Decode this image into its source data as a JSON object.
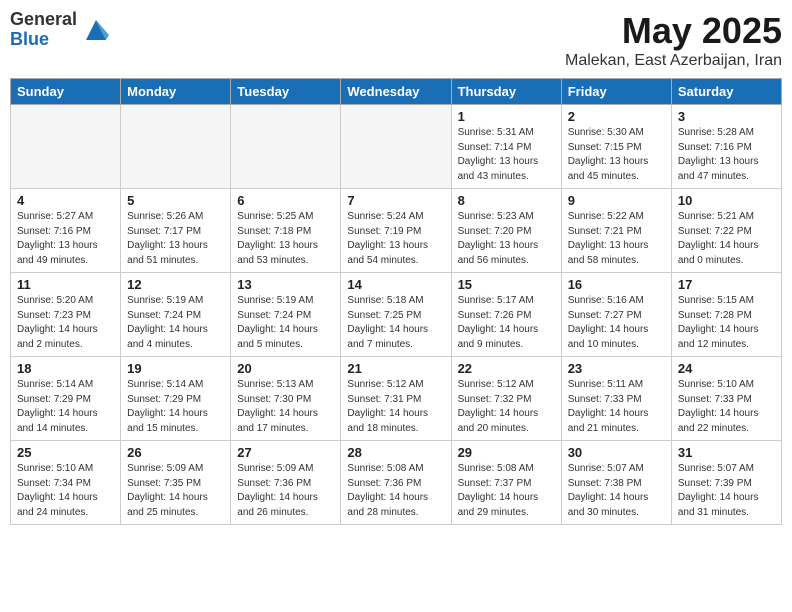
{
  "logo": {
    "general": "General",
    "blue": "Blue"
  },
  "title": {
    "month": "May 2025",
    "location": "Malekan, East Azerbaijan, Iran"
  },
  "headers": [
    "Sunday",
    "Monday",
    "Tuesday",
    "Wednesday",
    "Thursday",
    "Friday",
    "Saturday"
  ],
  "weeks": [
    [
      {
        "day": "",
        "info": "",
        "empty": true
      },
      {
        "day": "",
        "info": "",
        "empty": true
      },
      {
        "day": "",
        "info": "",
        "empty": true
      },
      {
        "day": "",
        "info": "",
        "empty": true
      },
      {
        "day": "1",
        "info": "Sunrise: 5:31 AM\nSunset: 7:14 PM\nDaylight: 13 hours\nand 43 minutes."
      },
      {
        "day": "2",
        "info": "Sunrise: 5:30 AM\nSunset: 7:15 PM\nDaylight: 13 hours\nand 45 minutes."
      },
      {
        "day": "3",
        "info": "Sunrise: 5:28 AM\nSunset: 7:16 PM\nDaylight: 13 hours\nand 47 minutes."
      }
    ],
    [
      {
        "day": "4",
        "info": "Sunrise: 5:27 AM\nSunset: 7:16 PM\nDaylight: 13 hours\nand 49 minutes."
      },
      {
        "day": "5",
        "info": "Sunrise: 5:26 AM\nSunset: 7:17 PM\nDaylight: 13 hours\nand 51 minutes."
      },
      {
        "day": "6",
        "info": "Sunrise: 5:25 AM\nSunset: 7:18 PM\nDaylight: 13 hours\nand 53 minutes."
      },
      {
        "day": "7",
        "info": "Sunrise: 5:24 AM\nSunset: 7:19 PM\nDaylight: 13 hours\nand 54 minutes."
      },
      {
        "day": "8",
        "info": "Sunrise: 5:23 AM\nSunset: 7:20 PM\nDaylight: 13 hours\nand 56 minutes."
      },
      {
        "day": "9",
        "info": "Sunrise: 5:22 AM\nSunset: 7:21 PM\nDaylight: 13 hours\nand 58 minutes."
      },
      {
        "day": "10",
        "info": "Sunrise: 5:21 AM\nSunset: 7:22 PM\nDaylight: 14 hours\nand 0 minutes."
      }
    ],
    [
      {
        "day": "11",
        "info": "Sunrise: 5:20 AM\nSunset: 7:23 PM\nDaylight: 14 hours\nand 2 minutes."
      },
      {
        "day": "12",
        "info": "Sunrise: 5:19 AM\nSunset: 7:24 PM\nDaylight: 14 hours\nand 4 minutes."
      },
      {
        "day": "13",
        "info": "Sunrise: 5:19 AM\nSunset: 7:24 PM\nDaylight: 14 hours\nand 5 minutes."
      },
      {
        "day": "14",
        "info": "Sunrise: 5:18 AM\nSunset: 7:25 PM\nDaylight: 14 hours\nand 7 minutes."
      },
      {
        "day": "15",
        "info": "Sunrise: 5:17 AM\nSunset: 7:26 PM\nDaylight: 14 hours\nand 9 minutes."
      },
      {
        "day": "16",
        "info": "Sunrise: 5:16 AM\nSunset: 7:27 PM\nDaylight: 14 hours\nand 10 minutes."
      },
      {
        "day": "17",
        "info": "Sunrise: 5:15 AM\nSunset: 7:28 PM\nDaylight: 14 hours\nand 12 minutes."
      }
    ],
    [
      {
        "day": "18",
        "info": "Sunrise: 5:14 AM\nSunset: 7:29 PM\nDaylight: 14 hours\nand 14 minutes."
      },
      {
        "day": "19",
        "info": "Sunrise: 5:14 AM\nSunset: 7:29 PM\nDaylight: 14 hours\nand 15 minutes."
      },
      {
        "day": "20",
        "info": "Sunrise: 5:13 AM\nSunset: 7:30 PM\nDaylight: 14 hours\nand 17 minutes."
      },
      {
        "day": "21",
        "info": "Sunrise: 5:12 AM\nSunset: 7:31 PM\nDaylight: 14 hours\nand 18 minutes."
      },
      {
        "day": "22",
        "info": "Sunrise: 5:12 AM\nSunset: 7:32 PM\nDaylight: 14 hours\nand 20 minutes."
      },
      {
        "day": "23",
        "info": "Sunrise: 5:11 AM\nSunset: 7:33 PM\nDaylight: 14 hours\nand 21 minutes."
      },
      {
        "day": "24",
        "info": "Sunrise: 5:10 AM\nSunset: 7:33 PM\nDaylight: 14 hours\nand 22 minutes."
      }
    ],
    [
      {
        "day": "25",
        "info": "Sunrise: 5:10 AM\nSunset: 7:34 PM\nDaylight: 14 hours\nand 24 minutes."
      },
      {
        "day": "26",
        "info": "Sunrise: 5:09 AM\nSunset: 7:35 PM\nDaylight: 14 hours\nand 25 minutes."
      },
      {
        "day": "27",
        "info": "Sunrise: 5:09 AM\nSunset: 7:36 PM\nDaylight: 14 hours\nand 26 minutes."
      },
      {
        "day": "28",
        "info": "Sunrise: 5:08 AM\nSunset: 7:36 PM\nDaylight: 14 hours\nand 28 minutes."
      },
      {
        "day": "29",
        "info": "Sunrise: 5:08 AM\nSunset: 7:37 PM\nDaylight: 14 hours\nand 29 minutes."
      },
      {
        "day": "30",
        "info": "Sunrise: 5:07 AM\nSunset: 7:38 PM\nDaylight: 14 hours\nand 30 minutes."
      },
      {
        "day": "31",
        "info": "Sunrise: 5:07 AM\nSunset: 7:39 PM\nDaylight: 14 hours\nand 31 minutes."
      }
    ]
  ]
}
